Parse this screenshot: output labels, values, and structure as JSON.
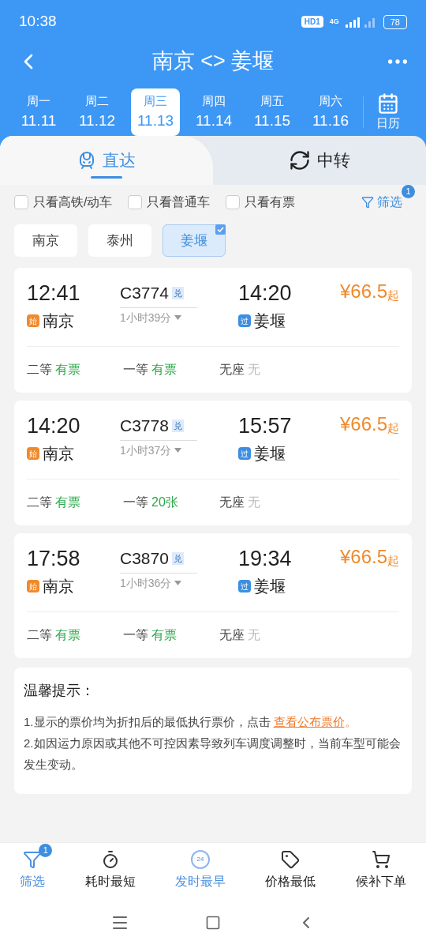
{
  "status_bar": {
    "time": "10:38",
    "hd": "HD1",
    "network": "4G",
    "battery": "78"
  },
  "header": {
    "title": "南京 <> 姜堰"
  },
  "dates": [
    {
      "weekday": "周一",
      "date": "11.11",
      "selected": false
    },
    {
      "weekday": "周二",
      "date": "11.12",
      "selected": false
    },
    {
      "weekday": "周三",
      "date": "11.13",
      "selected": true
    },
    {
      "weekday": "周四",
      "date": "11.14",
      "selected": false
    },
    {
      "weekday": "周五",
      "date": "11.15",
      "selected": false
    },
    {
      "weekday": "周六",
      "date": "11.16",
      "selected": false
    }
  ],
  "calendar_label": "日历",
  "tabs": [
    {
      "label": "直达",
      "selected": true
    },
    {
      "label": "中转",
      "selected": false
    }
  ],
  "filters": [
    {
      "label": "只看高铁/动车",
      "checked": false
    },
    {
      "label": "只看普通车",
      "checked": false
    },
    {
      "label": "只看有票",
      "checked": false
    }
  ],
  "filter_button": {
    "label": "筛选",
    "badge": "1"
  },
  "stations": [
    {
      "label": "南京",
      "selected": false
    },
    {
      "label": "泰州",
      "selected": false
    },
    {
      "label": "姜堰",
      "selected": true
    }
  ],
  "trains": [
    {
      "depart": "12:41",
      "from_tag": "始",
      "from": "南京",
      "number": "C3774",
      "number_tag": "兑",
      "duration": "1小时39分",
      "arrive": "14:20",
      "to_tag": "过",
      "to": "姜堰",
      "price": "¥66.5",
      "price_suffix": "起",
      "seats": [
        {
          "label": "二等",
          "value": "有票",
          "kind": "available"
        },
        {
          "label": "一等",
          "value": "有票",
          "kind": "available"
        },
        {
          "label": "无座",
          "value": "无",
          "kind": "none"
        }
      ]
    },
    {
      "depart": "14:20",
      "from_tag": "始",
      "from": "南京",
      "number": "C3778",
      "number_tag": "兑",
      "duration": "1小时37分",
      "arrive": "15:57",
      "to_tag": "过",
      "to": "姜堰",
      "price": "¥66.5",
      "price_suffix": "起",
      "seats": [
        {
          "label": "二等",
          "value": "有票",
          "kind": "available"
        },
        {
          "label": "一等",
          "value": "20张",
          "kind": "available"
        },
        {
          "label": "无座",
          "value": "无",
          "kind": "none"
        }
      ]
    },
    {
      "depart": "17:58",
      "from_tag": "始",
      "from": "南京",
      "number": "C3870",
      "number_tag": "兑",
      "duration": "1小时36分",
      "arrive": "19:34",
      "to_tag": "过",
      "to": "姜堰",
      "price": "¥66.5",
      "price_suffix": "起",
      "seats": [
        {
          "label": "二等",
          "value": "有票",
          "kind": "available"
        },
        {
          "label": "一等",
          "value": "有票",
          "kind": "available"
        },
        {
          "label": "无座",
          "value": "无",
          "kind": "none"
        }
      ]
    }
  ],
  "notice": {
    "title": "温馨提示：",
    "line1": "1.显示的票价均为折扣后的最低执行票价，点击",
    "link": "查看公布票价",
    "line1_end": "。",
    "line2": "2.如因运力原因或其他不可控因素导致列车调度调整时，当前车型可能会发生变动。"
  },
  "bottom_nav": [
    {
      "label": "筛选",
      "kind": "filter",
      "active": true,
      "badge": "1"
    },
    {
      "label": "耗时最短",
      "kind": "timer",
      "active": false
    },
    {
      "label": "发时最早",
      "kind": "clock24",
      "active": true,
      "icon_text": "24"
    },
    {
      "label": "价格最低",
      "kind": "tag",
      "active": false
    },
    {
      "label": "候补下单",
      "kind": "cart",
      "active": false
    }
  ]
}
